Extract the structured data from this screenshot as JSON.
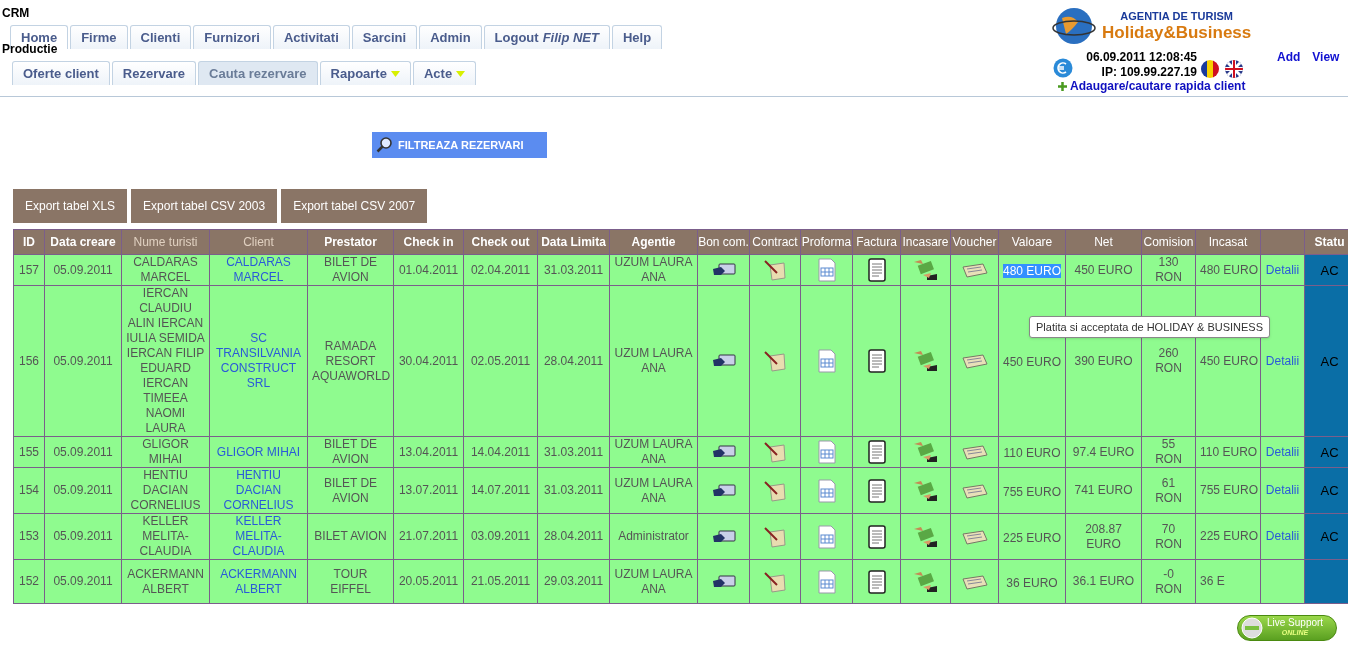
{
  "app_title": "CRM",
  "main_tabs": [
    {
      "label": "Home",
      "selected": true
    },
    {
      "label": "Firme",
      "selected": false
    },
    {
      "label": "Clienti",
      "selected": false
    },
    {
      "label": "Furnizori",
      "selected": false
    },
    {
      "label": "Activitati",
      "selected": false
    },
    {
      "label": "Sarcini",
      "selected": false
    },
    {
      "label": "Admin",
      "selected": false
    },
    {
      "label": "Logout",
      "user": "Filip NET",
      "selected": false
    },
    {
      "label": "Help",
      "selected": false
    }
  ],
  "section_label": "Productie",
  "sub_tabs": [
    {
      "label": "Oferte client",
      "selected": false,
      "dropdown": false
    },
    {
      "label": "Rezervare",
      "selected": false,
      "dropdown": false
    },
    {
      "label": "Cauta rezervare",
      "selected": true,
      "dropdown": false
    },
    {
      "label": "Rapoarte",
      "selected": false,
      "dropdown": true
    },
    {
      "label": "Acte",
      "selected": false,
      "dropdown": true
    }
  ],
  "header_right": {
    "logo_top": "AGENTIA DE TURISM",
    "logo_bottom": "Holiday&Business",
    "datetime": "06.09.2011 12:08:45",
    "ip": "IP: 109.99.227.19",
    "links": [
      "Add",
      "View"
    ],
    "quick_client": "Adaugare/cautare rapida client"
  },
  "filter_button": "FILTREAZA REZERVARI",
  "export_buttons": [
    "Export tabel XLS",
    "Export tabel CSV 2003",
    "Export tabel CSV 2007"
  ],
  "table": {
    "columns": [
      "ID",
      "Data creare",
      "Nume turisti",
      "Client",
      "Prestator",
      "Check in",
      "Check out",
      "Data Limita",
      "Agentie",
      "Bon com.",
      "Contract",
      "Proforma",
      "Factura",
      "Incasare",
      "Voucher",
      "Valoare",
      "Net",
      "Comision",
      "Incasat",
      "",
      "Statu"
    ],
    "rows": [
      {
        "id": "157",
        "created": "05.09.2011",
        "tourists": "CALDARAS MARCEL",
        "client": "CALDARAS MARCEL",
        "provider": "BILET DE AVION",
        "check_in": "01.04.2011",
        "check_out": "02.04.2011",
        "deadline": "31.03.2011",
        "agent": "UZUM LAURA ANA",
        "value": "480 EURO",
        "value_selected": true,
        "net": "450 EURO",
        "commission": "130 RON",
        "collected": "480 EURO",
        "details": "Detalii",
        "status": "AC"
      },
      {
        "id": "156",
        "created": "05.09.2011",
        "tourists": "IERCAN CLAUDIU ALIN IERCAN IULIA SEMIDA IERCAN FILIP EDUARD IERCAN TIMEEA NAOMI LAURA",
        "client": "SC TRANSILVANIA CONSTRUCT SRL",
        "provider": "RAMADA RESORT AQUAWORLD",
        "check_in": "30.04.2011",
        "check_out": "02.05.2011",
        "deadline": "28.04.2011",
        "agent": "UZUM LAURA ANA",
        "value": "450 EURO",
        "value_selected": false,
        "net": "390 EURO",
        "commission": "260 RON",
        "collected": "450 EURO",
        "details": "Detalii",
        "status": "AC"
      },
      {
        "id": "155",
        "created": "05.09.2011",
        "tourists": "GLIGOR MIHAI",
        "client": "GLIGOR MIHAI",
        "provider": "BILET DE AVION",
        "check_in": "13.04.2011",
        "check_out": "14.04.2011",
        "deadline": "31.03.2011",
        "agent": "UZUM LAURA ANA",
        "value": "110 EURO",
        "value_selected": false,
        "net": "97.4 EURO",
        "commission": "55 RON",
        "collected": "110 EURO",
        "details": "Detalii",
        "status": "AC"
      },
      {
        "id": "154",
        "created": "05.09.2011",
        "tourists": "HENTIU DACIAN CORNELIUS",
        "client": "HENTIU DACIAN CORNELIUS",
        "provider": "BILET DE AVION",
        "check_in": "13.07.2011",
        "check_out": "14.07.2011",
        "deadline": "31.03.2011",
        "agent": "UZUM LAURA ANA",
        "value": "755 EURO",
        "value_selected": false,
        "net": "741 EURO",
        "commission": "61 RON",
        "collected": "755 EURO",
        "details": "Detalii",
        "status": "AC"
      },
      {
        "id": "153",
        "created": "05.09.2011",
        "tourists": "KELLER MELITA-CLAUDIA",
        "client": "KELLER MELITA-CLAUDIA",
        "provider": "BILET AVION",
        "check_in": "21.07.2011",
        "check_out": "03.09.2011",
        "deadline": "28.04.2011",
        "agent": "Administrator",
        "value": "225 EURO",
        "value_selected": false,
        "net": "208.87 EURO",
        "commission": "70 RON",
        "collected": "225 EURO",
        "details": "Detalii",
        "status": "AC"
      },
      {
        "id": "152",
        "created": "05.09.2011",
        "tourists": "ACKERMANN ALBERT",
        "client": "ACKERMANN ALBERT",
        "provider": "TOUR EIFFEL",
        "check_in": "20.05.2011",
        "check_out": "21.05.2011",
        "deadline": "29.03.2011",
        "agent": "UZUM LAURA ANA",
        "value": "36 EURO",
        "value_selected": false,
        "net": "36.1 EURO",
        "commission": "-0 RON",
        "collected": "36 E"
      }
    ]
  },
  "tooltip": "Platita si acceptata de HOLIDAY & BUSINESS",
  "live_support": {
    "label": "Live Support",
    "status": "ONLINE"
  }
}
